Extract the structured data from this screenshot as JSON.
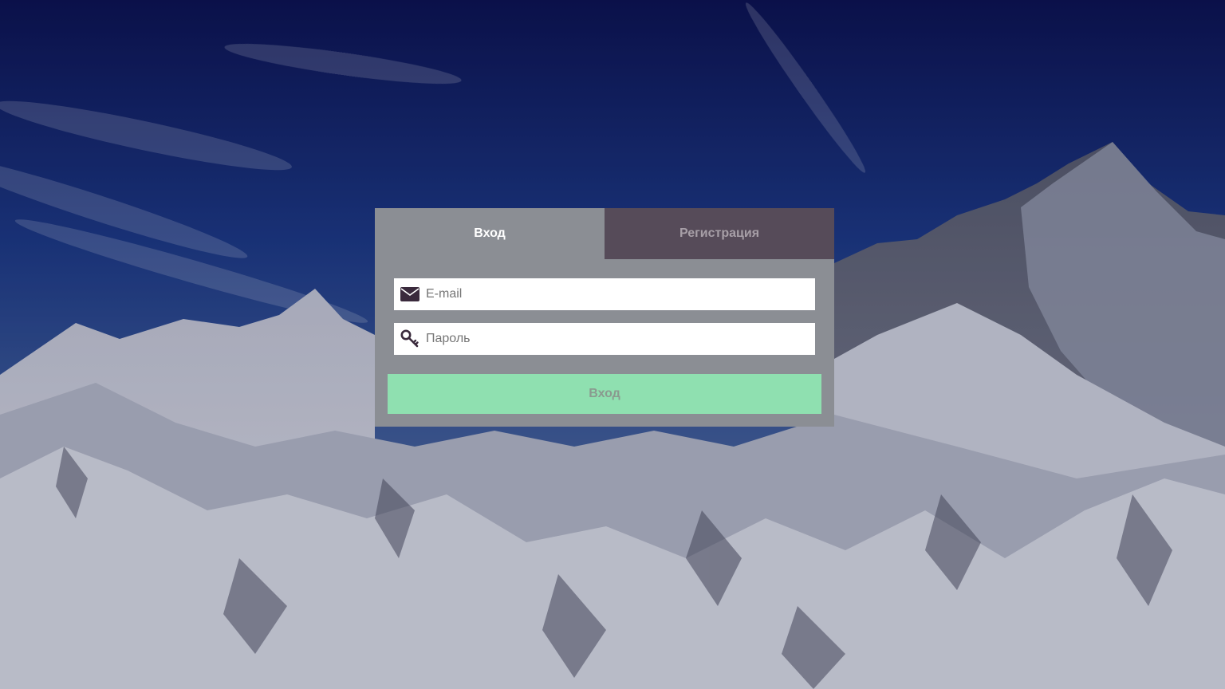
{
  "auth": {
    "tabs": {
      "login": "Вход",
      "register": "Регистрация"
    },
    "email": {
      "placeholder": "E-mail",
      "value": "",
      "icon": "envelope-icon"
    },
    "password": {
      "placeholder": "Пароль",
      "value": "",
      "icon": "key-icon"
    },
    "submit_label": "Вход"
  },
  "colors": {
    "card": "#8b8e94",
    "tab_inactive": "#564b59",
    "submit": "#8fe0b0",
    "icon": "#3a2a3c"
  }
}
